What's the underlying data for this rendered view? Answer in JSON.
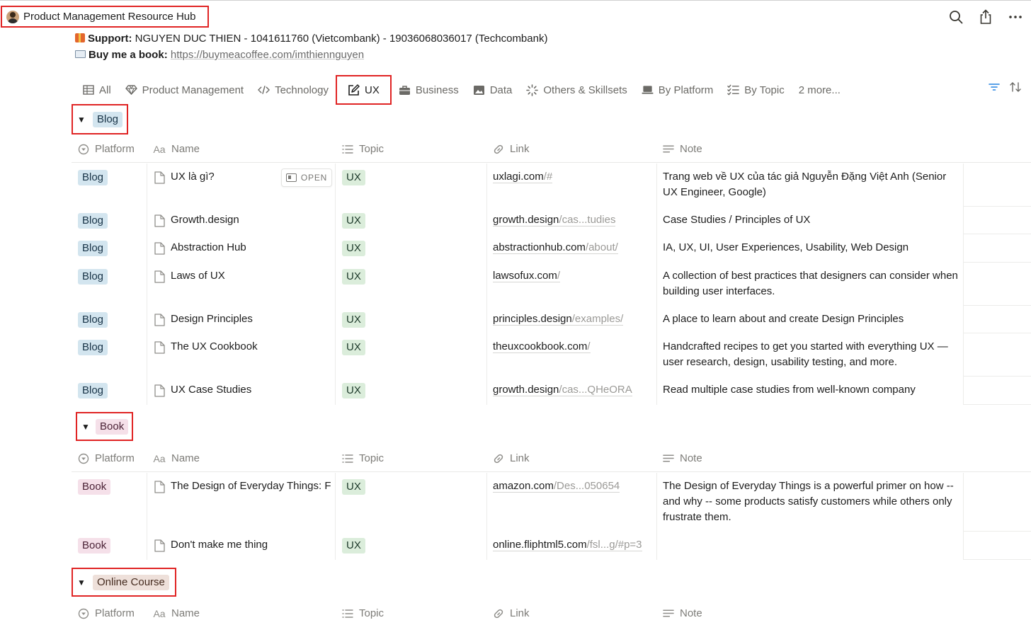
{
  "page": {
    "title": "Product Management Resource Hub",
    "support_label": "Support:",
    "support_text": "NGUYEN DUC THIEN - 1041611760 (Vietcombank) - 19036068036017 (Techcombank)",
    "book_label": "Buy me a book:",
    "book_url": "https://buymeacoffee.com/imthiennguyen"
  },
  "top_icons": [
    "search-icon",
    "share-icon",
    "more-icon"
  ],
  "tabs": [
    {
      "label": "All",
      "icon": "table-icon"
    },
    {
      "label": "Product Management",
      "icon": "gem-icon"
    },
    {
      "label": "Technology",
      "icon": "code-icon"
    },
    {
      "label": "UX",
      "icon": "edit-icon",
      "active": true
    },
    {
      "label": "Business",
      "icon": "briefcase-icon"
    },
    {
      "label": "Data",
      "icon": "image-icon"
    },
    {
      "label": "Others & Skillsets",
      "icon": "loader-icon"
    },
    {
      "label": "By Platform",
      "icon": "laptop-icon"
    },
    {
      "label": "By Topic",
      "icon": "checklist-icon"
    },
    {
      "label": "2 more...",
      "icon": ""
    }
  ],
  "columns": {
    "platform": "Platform",
    "name": "Name",
    "topic": "Topic",
    "link": "Link",
    "note": "Note"
  },
  "open_label": "OPEN",
  "groups": [
    {
      "label": "Blog",
      "rows": [
        {
          "platform": "Blog",
          "name": "UX là gì?",
          "topic": "UX",
          "link_main": "uxlagi.com",
          "link_rest": "/#",
          "note": "Trang web về UX của tác giả Nguyễn Đặng Việt Anh (Senior UX Engineer, Google)"
        },
        {
          "platform": "Blog",
          "name": "Growth.design",
          "topic": "UX",
          "link_main": "growth.design",
          "link_rest": "/cas...tudies",
          "note": "Case Studies / Principles of UX"
        },
        {
          "platform": "Blog",
          "name": "Abstraction Hub",
          "topic": "UX",
          "link_main": "abstractionhub.com",
          "link_rest": "/about/",
          "note": "IA, UX, UI, User Experiences, Usability, Web Design"
        },
        {
          "platform": "Blog",
          "name": "Laws of UX",
          "topic": "UX",
          "link_main": "lawsofux.com",
          "link_rest": "/",
          "note": "A collection of best practices that designers can consider when building user interfaces."
        },
        {
          "platform": "Blog",
          "name": "Design Principles",
          "topic": "UX",
          "link_main": "principles.design",
          "link_rest": "/examples/",
          "note": "A place to learn about and create Design Principles"
        },
        {
          "platform": "Blog",
          "name": "The UX Cookbook",
          "topic": "UX",
          "link_main": "theuxcookbook.com",
          "link_rest": "/",
          "note": "Handcrafted recipes to get you started with everything UX — user research, design, usability testing, and more."
        },
        {
          "platform": "Blog",
          "name": "UX Case Studies",
          "topic": "UX",
          "link_main": "growth.design",
          "link_rest": "/cas...QHeORA",
          "note": "Read multiple case studies from well-known company"
        }
      ]
    },
    {
      "label": "Book",
      "rows": [
        {
          "platform": "Book",
          "name": "The Design of Everyday Things: F",
          "topic": "UX",
          "link_main": "amazon.com",
          "link_rest": "/Des...050654",
          "note": "The Design of Everyday Things is a powerful primer on how -- and why -- some products satisfy customers while others only frustrate them."
        },
        {
          "platform": "Book",
          "name": "Don't make me thing",
          "topic": "UX",
          "link_main": "online.fliphtml5.com",
          "link_rest": "/fsl...g/#p=3",
          "note": ""
        }
      ]
    },
    {
      "label": "Online Course",
      "rows": []
    }
  ],
  "colors": {
    "highlight_box": "#e02424",
    "blue_tag": "#d3e5ef",
    "pink_tag": "#f5e0e9",
    "brown_tag": "#eee0da",
    "green_tag": "#dbeddb",
    "accent_blue": "#2383e2"
  }
}
